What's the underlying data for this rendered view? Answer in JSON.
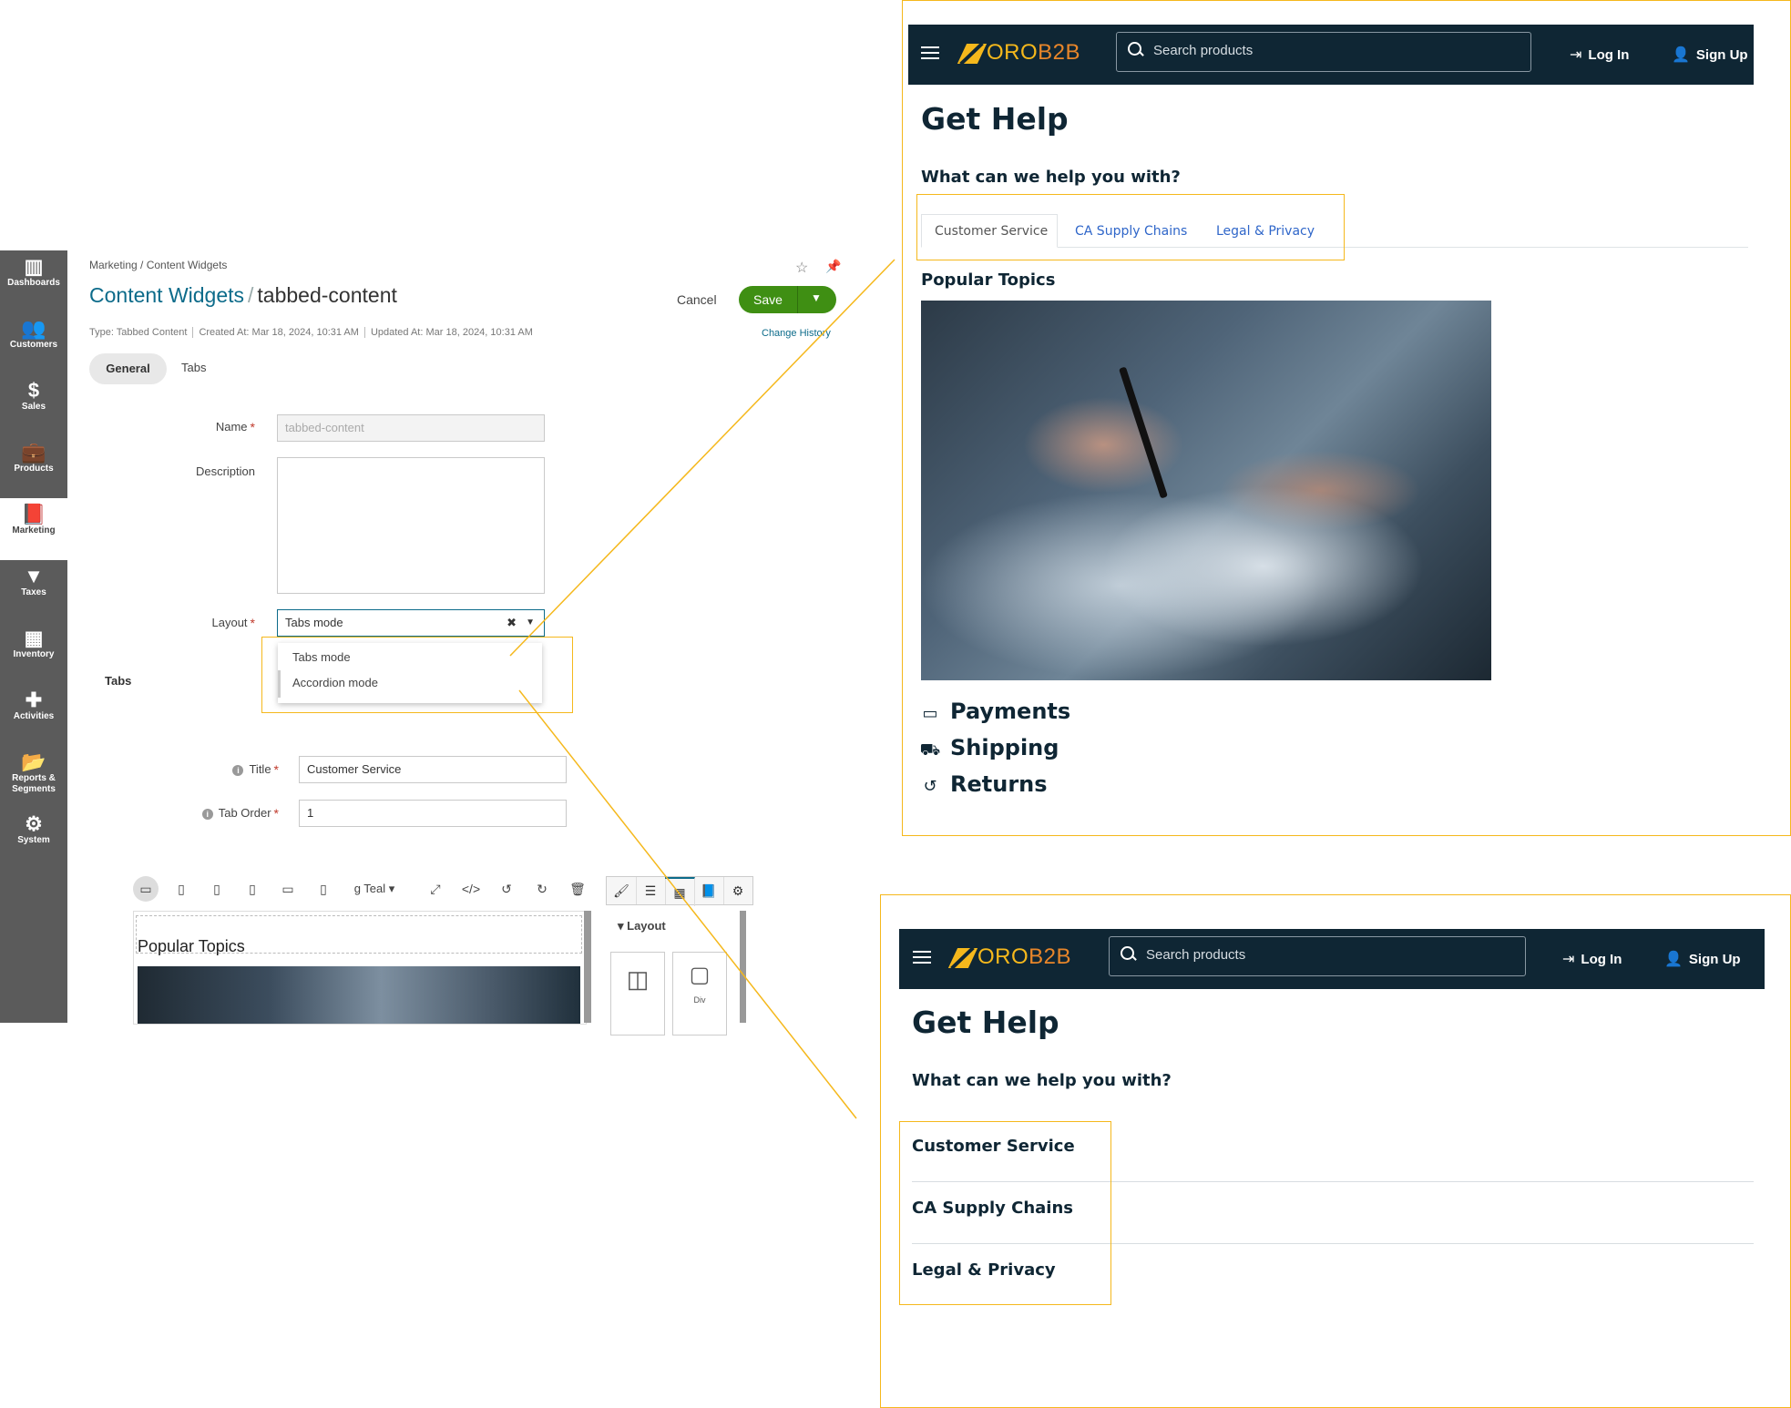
{
  "admin": {
    "sidebar": [
      {
        "label": "Dashboards",
        "icon": "dashboards-icon",
        "glyph": "▥"
      },
      {
        "label": "Customers",
        "icon": "customers-icon",
        "glyph": "👥"
      },
      {
        "label": "Sales",
        "icon": "dollar-icon",
        "glyph": "$"
      },
      {
        "label": "Products",
        "icon": "briefcase-icon",
        "glyph": "💼"
      },
      {
        "label": "Marketing",
        "icon": "book-icon",
        "glyph": "📕"
      },
      {
        "label": "Taxes",
        "icon": "filter-icon",
        "glyph": "▼"
      },
      {
        "label": "Inventory",
        "icon": "building-icon",
        "glyph": "▦"
      },
      {
        "label": "Activities",
        "icon": "puzzle-icon",
        "glyph": "✚"
      },
      {
        "label": "Reports & Segments",
        "icon": "folder-icon",
        "glyph": "📂"
      },
      {
        "label": "System",
        "icon": "gear-icon",
        "glyph": "⚙"
      }
    ],
    "breadcrumb": "Marketing / Content Widgets",
    "title_section": "Content Widgets",
    "title_separator": "/",
    "title_record": "tabbed-content",
    "meta": {
      "type": "Type: Tabbed Content",
      "created": "Created At: Mar 18, 2024, 10:31 AM",
      "updated": "Updated At: Mar 18, 2024, 10:31 AM"
    },
    "actions": {
      "cancel": "Cancel",
      "save": "Save",
      "change_history": "Change History"
    },
    "tabs": [
      "General",
      "Tabs"
    ],
    "form": {
      "name_label": "Name",
      "name_value": "tabbed-content",
      "description_label": "Description",
      "layout_label": "Layout",
      "layout_value": "Tabs mode",
      "layout_options": [
        "Tabs mode",
        "Accordion mode"
      ],
      "tabs_section": "Tabs",
      "title_label": "Title",
      "title_value": "Customer Service",
      "order_label": "Tab Order",
      "order_value": "1"
    },
    "editor": {
      "color_theme": "g Teal",
      "canvas_heading": "Popular Topics",
      "layout_panel": "Layout",
      "block_div": "Div"
    }
  },
  "storefront": {
    "logo": "OROB2B",
    "logo_primary": "ORO",
    "logo_secondary": "B2B",
    "search_placeholder": "Search products",
    "login": "Log In",
    "signup": "Sign Up",
    "heading": "Get Help",
    "subheading": "What can we help you with?",
    "tabs": [
      "Customer Service",
      "CA Supply Chains",
      "Legal & Privacy"
    ],
    "popular_topics": "Popular Topics",
    "topics": [
      {
        "label": "Payments",
        "icon": "credit-card-icon"
      },
      {
        "label": "Shipping",
        "icon": "truck-icon"
      },
      {
        "label": "Returns",
        "icon": "undo-icon"
      }
    ]
  },
  "colors": {
    "highlight": "#f5b81c",
    "navbar": "#0f2634",
    "accent_link": "#2f66c9",
    "save": "#3f8f13",
    "admin_link": "#0c6b8a"
  }
}
